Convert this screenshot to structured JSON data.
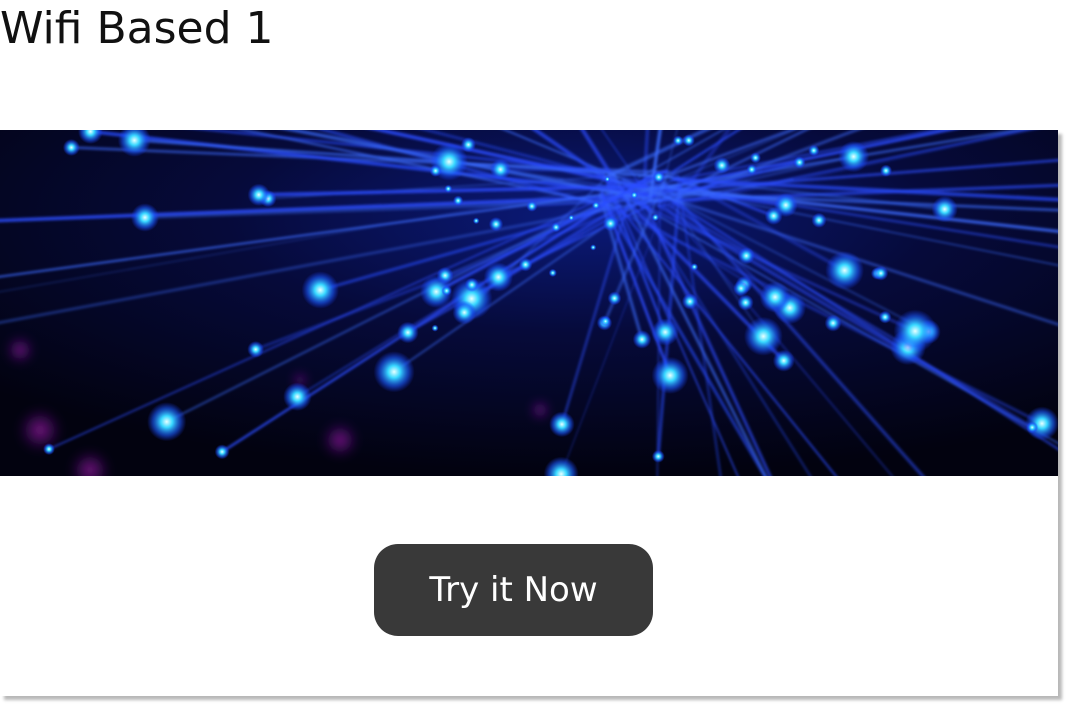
{
  "page": {
    "title": "Wifi Based 1"
  },
  "card": {
    "hero_image": "fiber-optic-lights",
    "cta_label": "Try it Now"
  },
  "colors": {
    "hero_background": "#020218",
    "fiber_glow": "#2ad4ff",
    "fiber_strand": "#2a4cff",
    "button_background": "#393939",
    "button_text": "#ffffff"
  }
}
